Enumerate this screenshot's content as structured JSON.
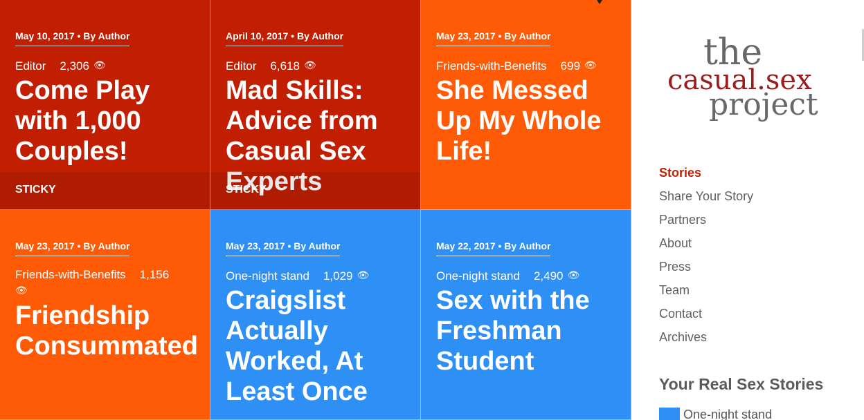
{
  "posts": [
    {
      "date": "May 10, 2017",
      "separator": " • By ",
      "author": "Author",
      "category": "Editor",
      "views": "2,306",
      "title": "Come Play with 1,000 Couples!",
      "sticky": "STICKY"
    },
    {
      "date": "April 10, 2017",
      "separator": " • By ",
      "author": "Author",
      "category": "Editor",
      "views": "6,618",
      "title": "Mad Skills: Advice from Casual Sex Experts",
      "sticky": "STICKY"
    },
    {
      "date": "May 23, 2017",
      "separator": " • By ",
      "author": "Author",
      "category": "Friends-with-Benefits",
      "views": "699",
      "title": "She Messed Up My Whole Life!"
    },
    {
      "date": "May 23, 2017",
      "separator": " • By ",
      "author": "Author",
      "category": "Friends-with-Benefits",
      "views": "1,156",
      "title": "Friendship Consummated"
    },
    {
      "date": "May 23, 2017",
      "separator": " • By ",
      "author": "Author",
      "category": "One-night stand",
      "views": "1,029",
      "title": "Craigslist Actually Worked, At Least Once"
    },
    {
      "date": "May 22, 2017",
      "separator": " • By ",
      "author": "Author",
      "category": "One-night stand",
      "views": "2,490",
      "title": "Sex with the Freshman Student"
    }
  ],
  "colors": {
    "red": "#c21f02",
    "orange": "#ff5b06",
    "blue": "#2e8ff5",
    "nav_active": "#c02208"
  },
  "icons": {
    "views": "eye-icon"
  },
  "eye_glyph": "👁",
  "sidebar": {
    "logo": {
      "line1": "the",
      "line2": "casual.sex",
      "line3": "project"
    },
    "nav": [
      "Stories",
      "Share Your Story",
      "Partners",
      "About",
      "Press",
      "Team",
      "Contact",
      "Archives"
    ],
    "active_nav": "Stories",
    "section_title": "Your Real Sex Stories",
    "legend": [
      {
        "label": "One-night stand",
        "color": "#2e8ff5"
      }
    ]
  }
}
